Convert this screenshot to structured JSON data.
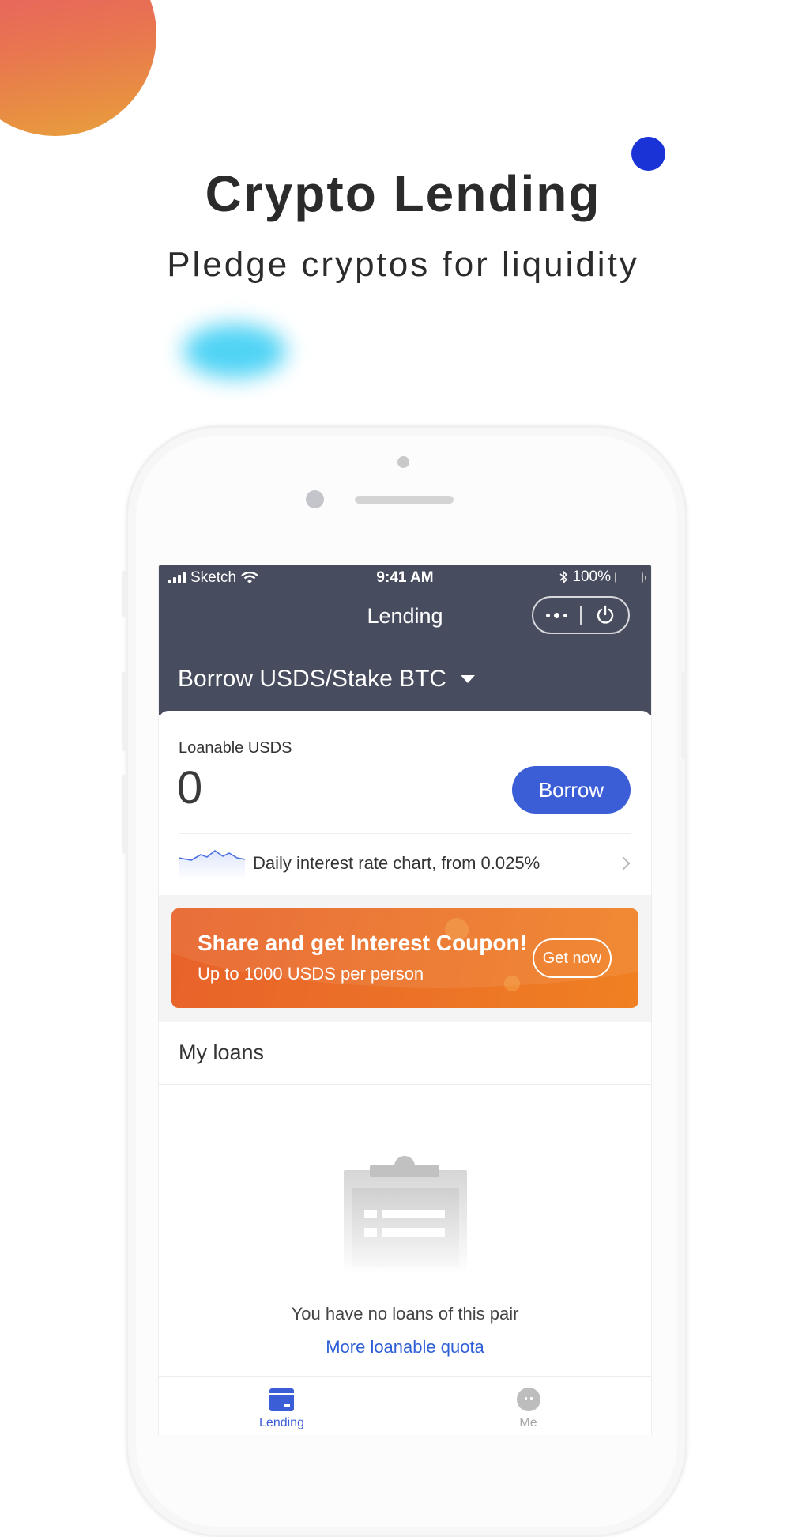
{
  "hero": {
    "title": "Crypto Lending",
    "subtitle": "Pledge cryptos for liquidity"
  },
  "colors": {
    "header_bg": "#474c5e",
    "accent_blue": "#3b5ed6",
    "promo_orange": "#eb7127",
    "deco_blue": "#1a33d6",
    "deco_cyan": "#4fd3f5"
  },
  "status_bar": {
    "carrier": "Sketch",
    "time": "9:41 AM",
    "battery": "100%"
  },
  "nav": {
    "title": "Lending",
    "more_icon": "more-dots-icon",
    "power_icon": "power-icon"
  },
  "pair_selector": {
    "value": "Borrow USDS/Stake BTC"
  },
  "loanable": {
    "label": "Loanable USDS",
    "amount": "0",
    "borrow_label": "Borrow"
  },
  "rate_row": {
    "text": "Daily interest rate chart, from 0.025%",
    "sparkline_icon": "sparkline-icon"
  },
  "promo": {
    "title": "Share and get Interest Coupon!",
    "subtitle": "Up to 1000 USDS per person",
    "button_label": "Get now"
  },
  "my_loans": {
    "title": "My loans",
    "empty_text": "You have no loans of this pair",
    "link_text": "More loanable quota"
  },
  "tabbar": {
    "tabs": [
      {
        "label": "Lending",
        "icon": "card-icon",
        "active": true
      },
      {
        "label": "Me",
        "icon": "face-icon",
        "active": false
      }
    ]
  }
}
